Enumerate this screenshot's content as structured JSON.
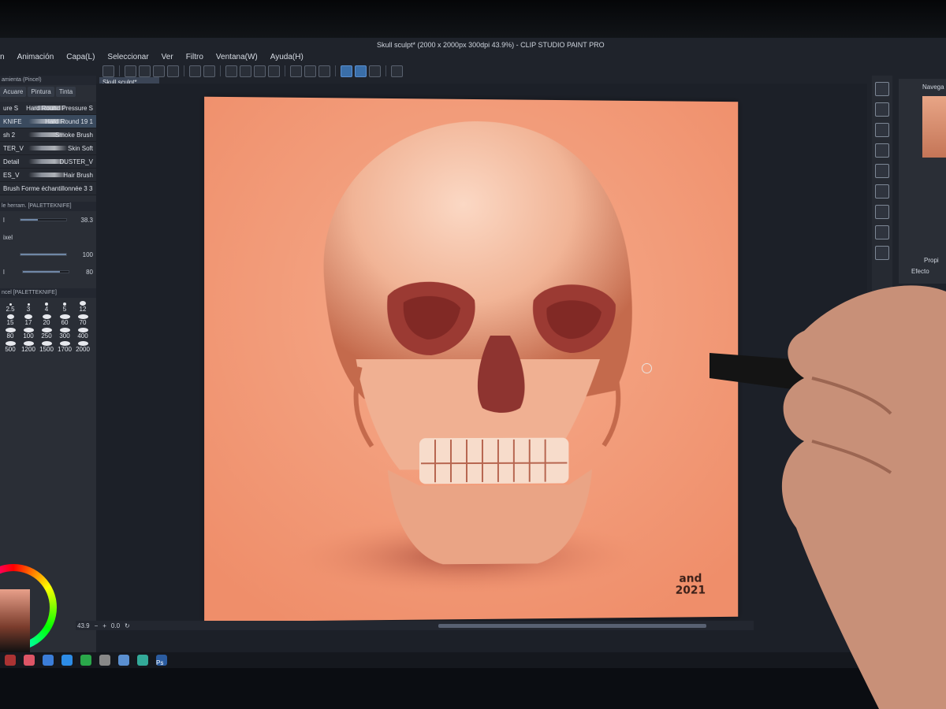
{
  "window": {
    "title": "Skull sculpt* (2000 x 2000px 300dpi 43.9%) - CLIP STUDIO PAINT PRO"
  },
  "menu": [
    "n",
    "Animación",
    "Capa(L)",
    "Seleccionar",
    "Ver",
    "Filtro",
    "Ventana(W)",
    "Ayuda(H)"
  ],
  "document_tab": "Skull sculpt*",
  "left_panel": {
    "tool_header": "amienta (Pincel)",
    "subtool_tabs": [
      "Acuare",
      "Pintura",
      "Tinta"
    ],
    "brushes": [
      {
        "left": "ure S",
        "right": "Hard Round Pressure S"
      },
      {
        "left": "KNIFE",
        "right": "Hard Round 19 1"
      },
      {
        "left": "sh 2",
        "right": "Smoke Brush"
      },
      {
        "left": "TER_V",
        "right": "Skin Soft"
      },
      {
        "left": "Detail",
        "right": "DUSTER_V"
      },
      {
        "left": "ES_V",
        "right": "Hair Brush"
      },
      {
        "left": "Brush Forme échantillonnée 3 3",
        "right": ""
      }
    ],
    "tool_property_header": "le herram. [PALETTEKNIFE]",
    "properties": [
      {
        "label": "l",
        "value": "38.3",
        "fill": 0.38
      },
      {
        "label": "ixel",
        "value": "",
        "fill": 0
      },
      {
        "label": "",
        "value": "100",
        "fill": 1.0
      },
      {
        "label": "l",
        "value": "80",
        "fill": 0.8
      }
    ],
    "brush_size_header": "ncel [PALETTEKNIFE]",
    "brush_sizes": [
      "2.5",
      "3",
      "4",
      "5",
      "12",
      "15",
      "17",
      "20",
      "60",
      "70",
      "80",
      "100",
      "250",
      "300",
      "400",
      "500",
      "1200",
      "1500",
      "1700",
      "2000"
    ]
  },
  "color": {
    "r": "221",
    "g": "153",
    "b": "98",
    "accent": "#f4a07e"
  },
  "canvas": {
    "signature_line1": "and",
    "signature_line2": "2021"
  },
  "status": {
    "zoom": "43.9",
    "rotation": "0.0"
  },
  "right_panel": {
    "navigator_label": "Navega",
    "properties_label": "Propi",
    "effect_label": "Efecto"
  },
  "taskbar": {
    "ps_label": "Ps"
  }
}
